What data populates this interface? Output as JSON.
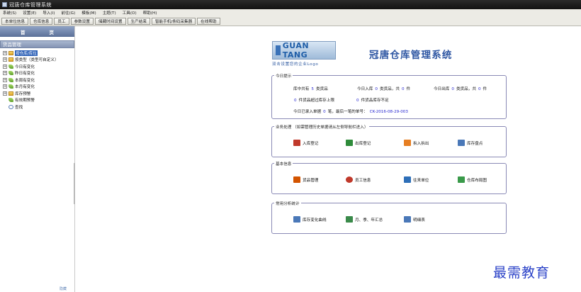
{
  "window": {
    "title": "冠唐仓库管理系统"
  },
  "menu": [
    "系统(S)",
    "设置(E)",
    "导入(I)",
    "前往(G)",
    "模板(M)",
    "主题(T)",
    "工具(O)",
    "帮助(H)"
  ],
  "toolbar": [
    "本单位信息",
    "仓库信息",
    "员工",
    "参数设置",
    "储藏时间设置",
    "生产结束",
    "智能手机/条码采集器",
    "在线帮助"
  ],
  "sidebar": {
    "home": [
      "首",
      "页"
    ],
    "panel_title": "货品管理",
    "tree": [
      {
        "label": "按仓库/库位",
        "expander": "+",
        "icon": "folder",
        "selected": true
      },
      {
        "label": "按类型（类型可自定义）",
        "expander": "+",
        "icon": "folder"
      },
      {
        "label": "今日有变化",
        "expander": "+",
        "icon": "leaf"
      },
      {
        "label": "昨日有变化",
        "expander": "+",
        "icon": "leaf"
      },
      {
        "label": "本周有变化",
        "expander": "+",
        "icon": "leaf"
      },
      {
        "label": "本月有变化",
        "expander": "+",
        "icon": "leaf"
      },
      {
        "label": "库存预警",
        "expander": "+",
        "icon": "folder"
      },
      {
        "label": "有效期预警",
        "expander": "",
        "icon": "leaf"
      },
      {
        "label": "查找",
        "expander": "",
        "icon": "search"
      }
    ],
    "footer": "隐藏"
  },
  "logo": {
    "mark": "GUAN TANG",
    "sub": "双击设置您的企业Logo"
  },
  "system_title": "冠唐仓库管理系统",
  "today": {
    "title": "今日提示",
    "l1a": "库中共有",
    "l1a_n": "5",
    "l1a_u": "类货品",
    "l1b": "今日入库",
    "l1b_n": "0",
    "l1b_u": "类货品，共",
    "l1b_m": "0",
    "l1b_v": "件",
    "l1c": "今日出库",
    "l1c_n": "0",
    "l1c_u": "类货品，共",
    "l1c_m": "0",
    "l1c_v": "件",
    "l2a_n": "0",
    "l2a": "件货品超过库存上限",
    "l2b_n": "0",
    "l2b": "件货品库存不足",
    "l3": "今日已录入单据",
    "l3_n": "0",
    "l3_u": "笔，最后一笔的单号：",
    "l3_d": "CK-2016-08-29-003"
  },
  "business": {
    "title": "业务处理 （如需管理历史单据请从左侧导航栏进入）",
    "items": [
      {
        "label": "入库登记",
        "color": "#c0392b"
      },
      {
        "label": "出库登记",
        "color": "#2e8b3a"
      },
      {
        "label": "拆入拆出",
        "color": "#e67e22"
      },
      {
        "label": "库存盘点",
        "color": "#4a78b8"
      }
    ]
  },
  "basic": {
    "title": "基本信息",
    "items": [
      {
        "label": "货品管理",
        "color": "#d35400"
      },
      {
        "label": "员工信息",
        "color": "#c0392b"
      },
      {
        "label": "往来单位",
        "color": "#2e6fb8"
      },
      {
        "label": "仓库布局图",
        "color": "#3a9a4a"
      }
    ]
  },
  "analysis": {
    "title": "常用分析统计",
    "items": [
      {
        "label": "库存变化曲线",
        "color": "#4a78b8"
      },
      {
        "label": "月、季、年汇总",
        "color": "#3a8a4a"
      },
      {
        "label": "明细表",
        "color": "#4a78b8"
      }
    ]
  },
  "watermark": "最需教育"
}
